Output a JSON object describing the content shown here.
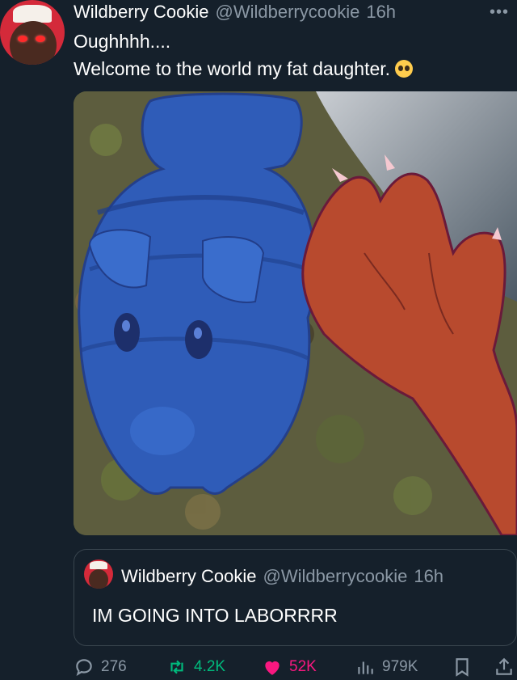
{
  "tweet": {
    "author_name": "Wildberry Cookie",
    "author_handle": "@Wildberrycookie",
    "time": "16h",
    "more_label": "•••",
    "text_line1": "Oughhhh....",
    "text_line2": "Welcome to the world my fat daughter.",
    "emoji_icon": "pleading-face-icon"
  },
  "media": {
    "description_icon": "drawing-over-photo"
  },
  "quote": {
    "author_name": "Wildberry Cookie",
    "author_handle": "@Wildberrycookie",
    "time": "16h",
    "text": "IM GOING INTO LABORRRR"
  },
  "actions": {
    "replies": "276",
    "retweets": "4.2K",
    "likes": "52K",
    "views": "979K"
  },
  "colors": {
    "background": "#15202b",
    "secondary_text": "#8b98a5",
    "retweet_green": "#00ba7c",
    "like_pink": "#f91880"
  }
}
